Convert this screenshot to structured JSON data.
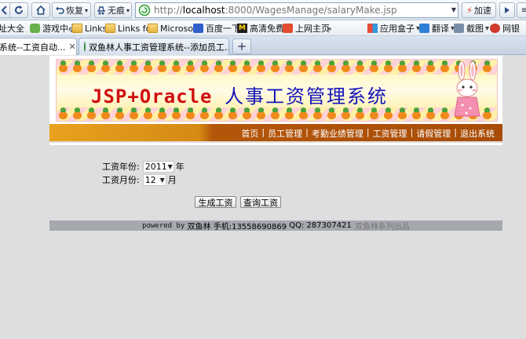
{
  "browser": {
    "nav_buttons": {
      "restore_label": "恢复",
      "no_trace_label": "无痕"
    },
    "address": {
      "prefix": "http://",
      "host": "localhost",
      "rest": ":8000/WagesManage/salaryMake.jsp"
    },
    "right_buttons": {
      "accelerate_label": "加速"
    },
    "bookmarks": [
      {
        "label": "址大全",
        "icon": "folder-icon"
      },
      {
        "label": "游戏中心",
        "icon": "gamepad-icon"
      },
      {
        "label": "Links",
        "icon": "folder-icon"
      },
      {
        "label": "Links fo",
        "icon": "folder-icon"
      },
      {
        "label": "Microso",
        "icon": "folder-icon"
      },
      {
        "label": "百度一下",
        "icon": "baidu-icon"
      },
      {
        "label": "高清免费",
        "icon": "m-icon"
      },
      {
        "label": "上网主页",
        "icon": "home-icon"
      }
    ],
    "bookmarks_overflow": "»",
    "extensions": [
      {
        "label": "应用盒子",
        "icon": "app-box-icon"
      },
      {
        "label": "翻译",
        "icon": "translate-icon"
      },
      {
        "label": "截图",
        "icon": "screenshot-icon"
      },
      {
        "label": "网银",
        "icon": "bank-icon"
      }
    ],
    "tabs": [
      {
        "title": "系统--工资自动...",
        "active": true
      },
      {
        "title": "双鱼林人事工资管理系统--添加员工...",
        "active": false
      }
    ],
    "new_tab_symbol": "+"
  },
  "banner": {
    "title_latin": "JSP+Oracle",
    "title_cn": "人事工资管理系统"
  },
  "nav": {
    "items": [
      {
        "label": "首页"
      },
      {
        "label": "员工管理"
      },
      {
        "label": "考勤业绩管理"
      },
      {
        "label": "工资管理"
      },
      {
        "label": "请假管理"
      },
      {
        "label": "退出系统"
      }
    ],
    "separator": "|"
  },
  "form": {
    "year_label": "工资年份:",
    "year_value": "2011",
    "year_unit": "年",
    "month_label": "工资月份:",
    "month_value": "12",
    "month_unit": "月",
    "generate_button": "生成工资",
    "query_button": "查询工资"
  },
  "footer": {
    "powered": "powered by",
    "author": "双鱼林",
    "phone": "手机:13558690869",
    "qq": "QQ: 287307421",
    "series": "双鱼林系列出品"
  }
}
